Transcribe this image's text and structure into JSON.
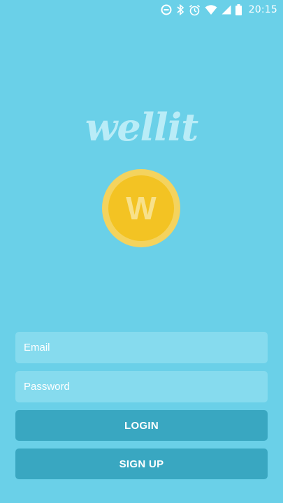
{
  "status_bar": {
    "time": "20:15",
    "icons": [
      "data-saver-icon",
      "bluetooth-icon",
      "alarm-icon",
      "wifi-icon",
      "signal-icon",
      "battery-icon"
    ]
  },
  "brand": {
    "logo_text": "wellit",
    "coin_letter": "W"
  },
  "form": {
    "email_placeholder": "Email",
    "password_placeholder": "Password",
    "login_label": "LOGIN",
    "signup_label": "SIGN UP"
  },
  "colors": {
    "background": "#6ad0e8",
    "field": "#86dbee",
    "button": "#39a7c1",
    "coin_outer": "#f4d35e",
    "coin_inner": "#f3c323"
  }
}
